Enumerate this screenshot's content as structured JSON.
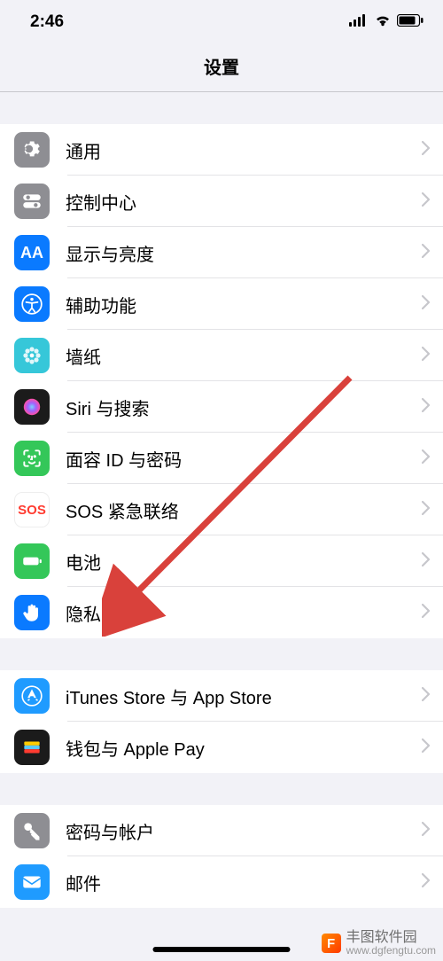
{
  "status": {
    "time": "2:46"
  },
  "header": {
    "title": "设置"
  },
  "groups": [
    {
      "items": [
        {
          "id": "general",
          "label": "通用",
          "icon": "gear",
          "bg": "#8e8e93"
        },
        {
          "id": "control-center",
          "label": "控制中心",
          "icon": "switches",
          "bg": "#8e8e93"
        },
        {
          "id": "display",
          "label": "显示与亮度",
          "icon": "AA",
          "bg": "#0a7aff"
        },
        {
          "id": "accessibility",
          "label": "辅助功能",
          "icon": "person-circle",
          "bg": "#0a7aff"
        },
        {
          "id": "wallpaper",
          "label": "墙纸",
          "icon": "flower",
          "bg": "#36c7d9"
        },
        {
          "id": "siri",
          "label": "Siri 与搜索",
          "icon": "siri",
          "bg": "#1b1b1b"
        },
        {
          "id": "faceid",
          "label": "面容 ID 与密码",
          "icon": "face",
          "bg": "#34c759"
        },
        {
          "id": "sos",
          "label": "SOS 紧急联络",
          "icon": "SOS",
          "bg": "#ffffff",
          "fg": "#ff3b30"
        },
        {
          "id": "battery",
          "label": "电池",
          "icon": "battery",
          "bg": "#34c759"
        },
        {
          "id": "privacy",
          "label": "隐私",
          "icon": "hand",
          "bg": "#0a7aff"
        }
      ]
    },
    {
      "items": [
        {
          "id": "itunes",
          "label": "iTunes Store 与 App Store",
          "icon": "appstore",
          "bg": "#1f9bff"
        },
        {
          "id": "wallet",
          "label": "钱包与 Apple Pay",
          "icon": "wallet",
          "bg": "#1b1b1b"
        }
      ]
    },
    {
      "items": [
        {
          "id": "passwords",
          "label": "密码与帐户",
          "icon": "key",
          "bg": "#8e8e93"
        },
        {
          "id": "mail",
          "label": "邮件",
          "icon": "mail",
          "bg": "#1f9bff"
        }
      ]
    }
  ],
  "watermark": {
    "brand": "丰图软件园",
    "site": "www.dgfengtu.com",
    "logo_text": "F"
  }
}
